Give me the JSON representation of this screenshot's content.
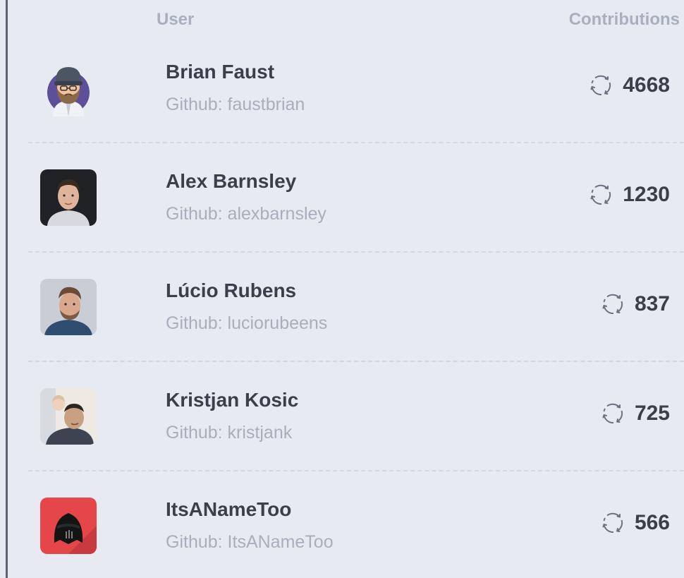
{
  "header": {
    "user_label": "User",
    "contributions_label": "Contributions"
  },
  "contributors": [
    {
      "name": "Brian Faust",
      "handle": "Github: faustbrian",
      "contributions": "4668",
      "avatar": "cartoon-bearded-man-avatar"
    },
    {
      "name": "Alex Barnsley",
      "handle": "Github: alexbarnsley",
      "contributions": "1230",
      "avatar": "photo-avatar"
    },
    {
      "name": "Lúcio Rubens",
      "handle": "Github: luciorubeens",
      "contributions": "837",
      "avatar": "photo-avatar"
    },
    {
      "name": "Kristjan Kosic",
      "handle": "Github: kristjank",
      "contributions": "725",
      "avatar": "photo-avatar"
    },
    {
      "name": "ItsANameToo",
      "handle": "Github: ItsANameToo",
      "contributions": "566",
      "avatar": "helmet-avatar"
    }
  ],
  "colors": {
    "background": "#e7eaf1",
    "text_primary": "#3a3f4a",
    "text_muted": "#a8afbb",
    "divider": "#d3d8e1",
    "accent_red": "#e5464a"
  },
  "icons": {
    "contributions": "refresh-cycle-icon"
  }
}
